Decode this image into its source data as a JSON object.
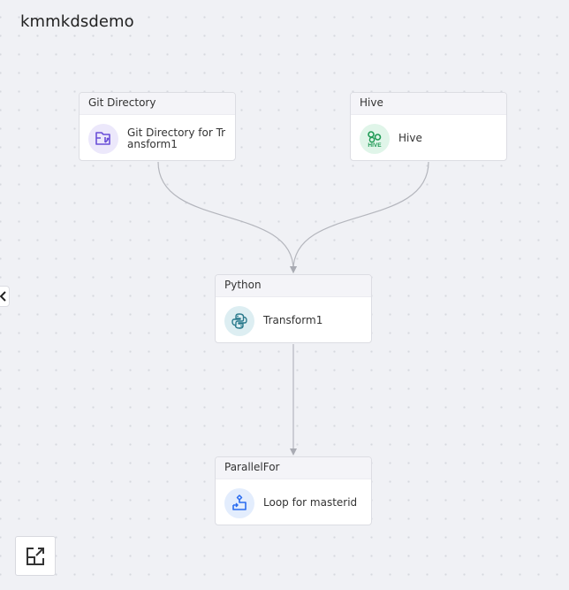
{
  "canvas": {
    "title": "kmmkdsdemo"
  },
  "nodes": [
    {
      "id": "git",
      "type": "Git Directory",
      "label": "Git Directory for Transform1",
      "icon": "git-folder-icon",
      "icon_color": "#6a4fd8",
      "icon_bg": "#ece8fb"
    },
    {
      "id": "hive",
      "type": "Hive",
      "label": "Hive",
      "icon": "hive-icon",
      "icon_color": "#1f9a55",
      "icon_bg": "#e0f5e9"
    },
    {
      "id": "python",
      "type": "Python",
      "label": "Transform1",
      "icon": "python-icon",
      "icon_color": "#2a7a8c",
      "icon_bg": "#ddeef2"
    },
    {
      "id": "parallelfor",
      "type": "ParallelFor",
      "label": "Loop for masterid",
      "icon": "loop-icon",
      "icon_color": "#2a6cf0",
      "icon_bg": "#e3edfd"
    }
  ],
  "edges": [
    {
      "from": "git",
      "to": "python"
    },
    {
      "from": "hive",
      "to": "python"
    },
    {
      "from": "python",
      "to": "parallelfor"
    }
  ],
  "controls": {
    "collapse_panel": "chevron-left-icon",
    "fit_view": "expand-view-icon"
  }
}
